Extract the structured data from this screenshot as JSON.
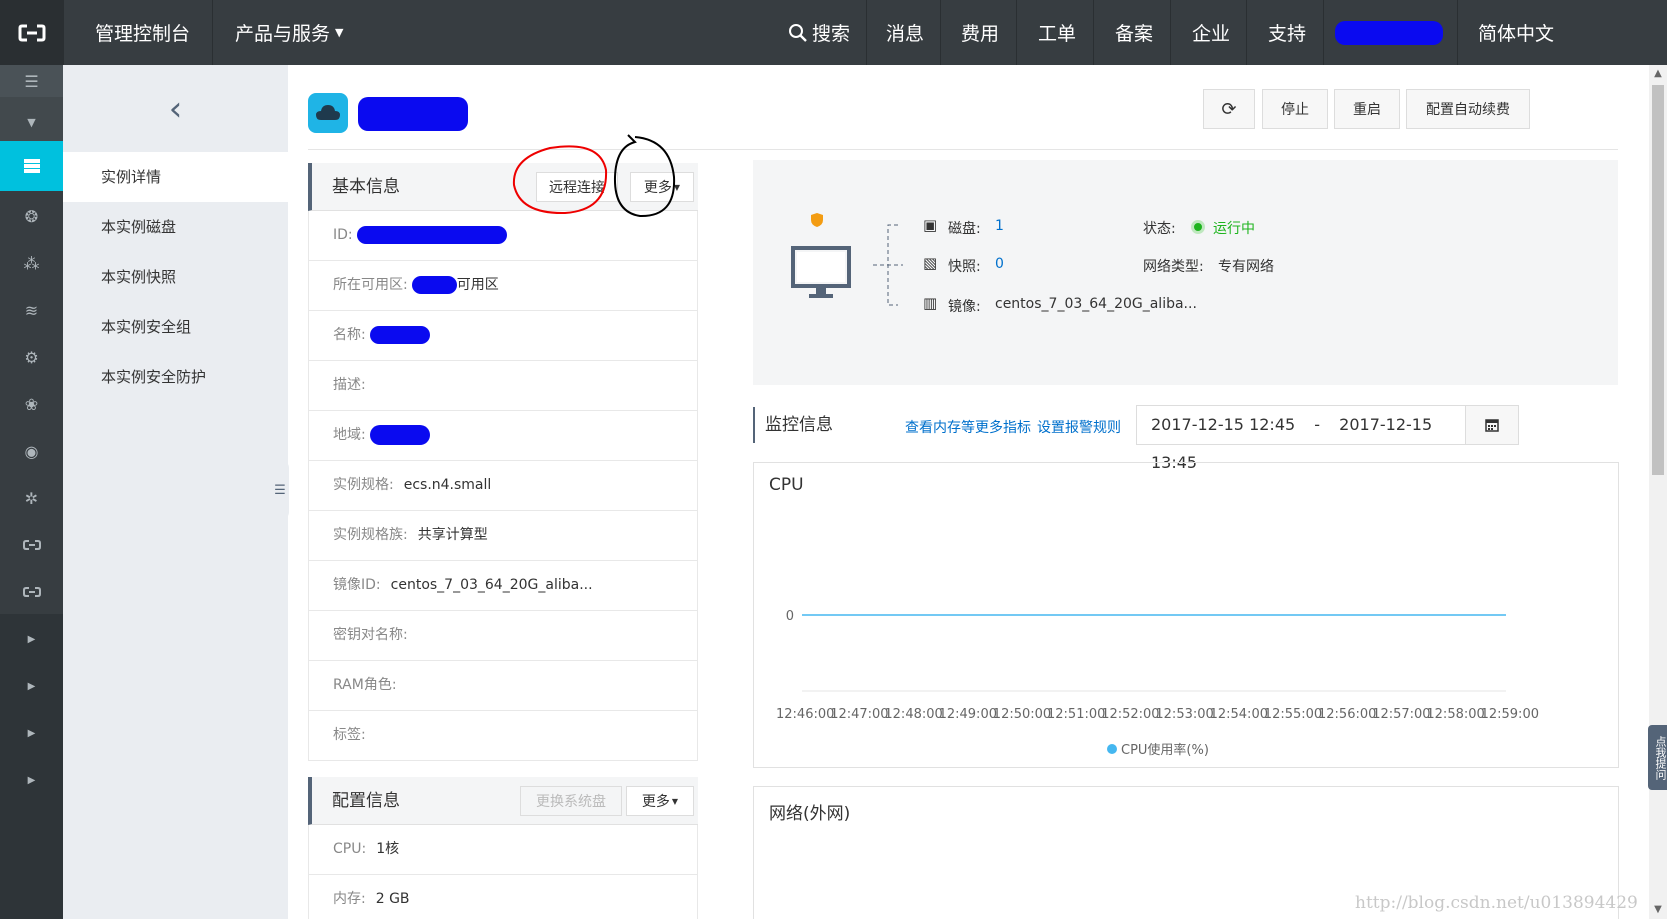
{
  "topbar": {
    "console": "管理控制台",
    "products": "产品与服务",
    "search": "搜索",
    "messages": "消息",
    "billing": "费用",
    "tickets": "工单",
    "icp": "备案",
    "enterprise": "企业",
    "support": "支持",
    "language": "简体中文"
  },
  "subnav": {
    "items": [
      {
        "label": "实例详情"
      },
      {
        "label": "本实例磁盘"
      },
      {
        "label": "本实例快照"
      },
      {
        "label": "本实例安全组"
      },
      {
        "label": "本实例安全防护"
      }
    ]
  },
  "toolbar": {
    "stop": "停止",
    "restart": "重启",
    "auto_renew": "配置自动续费"
  },
  "basic": {
    "title": "基本信息",
    "remote": "远程连接",
    "more": "更多",
    "rows": [
      {
        "label": "ID:",
        "value": ""
      },
      {
        "label": "所在可用区:",
        "value": "可用区"
      },
      {
        "label": "名称:",
        "value": ""
      },
      {
        "label": "描述:",
        "value": ""
      },
      {
        "label": "地域:",
        "value": ""
      },
      {
        "label": "实例规格:",
        "value": "ecs.n4.small"
      },
      {
        "label": "实例规格族:",
        "value": "共享计算型"
      },
      {
        "label": "镜像ID:",
        "value": "centos_7_03_64_20G_aliba..."
      },
      {
        "label": "密钥对名称:",
        "value": ""
      },
      {
        "label": "RAM角色:",
        "value": ""
      },
      {
        "label": "标签:",
        "value": ""
      }
    ]
  },
  "config": {
    "title": "配置信息",
    "change_disk": "更换系统盘",
    "more": "更多",
    "rows": [
      {
        "label": "CPU:",
        "value": "1核"
      },
      {
        "label": "内存:",
        "value": "2 GB"
      }
    ]
  },
  "summary": {
    "disk_label": "磁盘:",
    "disk_value": "1",
    "snapshot_label": "快照:",
    "snapshot_value": "0",
    "image_label": "镜像:",
    "image_value": "centos_7_03_64_20G_aliba...",
    "status_label": "状态:",
    "status_value": "运行中",
    "network_label": "网络类型:",
    "network_value": "专有网络",
    "colors": {
      "running": "#1eb41e",
      "link": "#0070cc"
    }
  },
  "monitor": {
    "title": "监控信息",
    "more_metrics": "查看内存等更多指标",
    "alarm_rules": "设置报警规则",
    "date_from": "2017-12-15 12:45",
    "date_sep": "-",
    "date_to": "2017-12-15 13:45"
  },
  "chart_data": {
    "type": "line",
    "title": "CPU",
    "x": [
      "12:46:00",
      "12:47:00",
      "12:48:00",
      "12:49:00",
      "12:50:00",
      "12:51:00",
      "12:52:00",
      "12:53:00",
      "12:54:00",
      "12:55:00",
      "12:56:00",
      "12:57:00",
      "12:58:00",
      "12:59:00"
    ],
    "series": [
      {
        "name": "CPU使用率(%)",
        "values": [
          0,
          0,
          0,
          0,
          0,
          0,
          0,
          0,
          0,
          0,
          0,
          0,
          0,
          0
        ]
      }
    ],
    "y_tick": "0",
    "legend_position": "bottom",
    "color": "#45b7f0"
  },
  "network": {
    "title": "网络(外网)"
  },
  "feedback": "点我提问",
  "watermark": "http://blog.csdn.net/u013894429"
}
